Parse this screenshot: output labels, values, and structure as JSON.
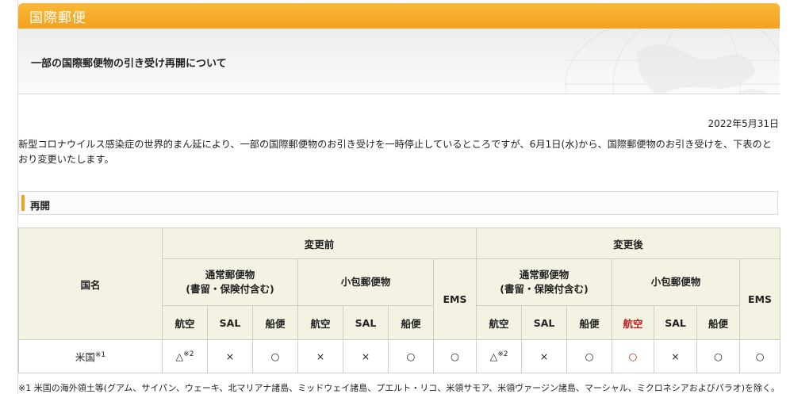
{
  "header": {
    "title": "国際郵便"
  },
  "notice": {
    "title": "一部の国際郵便物の引き受け再開について"
  },
  "date": "2022年5月31日",
  "intro": "新型コロナウイルス感染症の世界的まん延により、一部の国際郵便物のお引き受けを一時停止しているところですが、6月1日(水)から、国際郵便物のお引き受けを、下表のとおり変更いたします。",
  "section": {
    "label": "再開"
  },
  "table": {
    "country_header": "国名",
    "before_header": "変更前",
    "after_header": "変更後",
    "normal_mail": "通常郵便物",
    "normal_mail_note": "(書留・保険付含む)",
    "parcel": "小包郵便物",
    "ems": "EMS",
    "air": "航空",
    "sal": "SAL",
    "ship": "船便",
    "row": {
      "country": "米国",
      "country_note": "※1",
      "before": {
        "normal_air": "△",
        "normal_air_note": "※2",
        "normal_sal": "×",
        "normal_ship": "○",
        "parcel_air": "×",
        "parcel_sal": "×",
        "parcel_ship": "○",
        "ems": "○"
      },
      "after": {
        "normal_air": "△",
        "normal_air_note": "※2",
        "normal_sal": "×",
        "normal_ship": "○",
        "parcel_air": "○",
        "parcel_sal": "×",
        "parcel_ship": "○",
        "ems": "○"
      }
    }
  },
  "footnote": "※1 米国の海外領土等(グアム、サイパン、ウェーキ、北マリアナ諸島、ミッドウェイ諸島、プエルト・リコ、米領サモア、米領ヴァージン諸島、マーシャル、ミクロネシアおよびパラオ)を除く。",
  "colors": {
    "accent": "#f3a11c",
    "header_bg": "#f4f2e2",
    "highlight": "#b22222"
  }
}
